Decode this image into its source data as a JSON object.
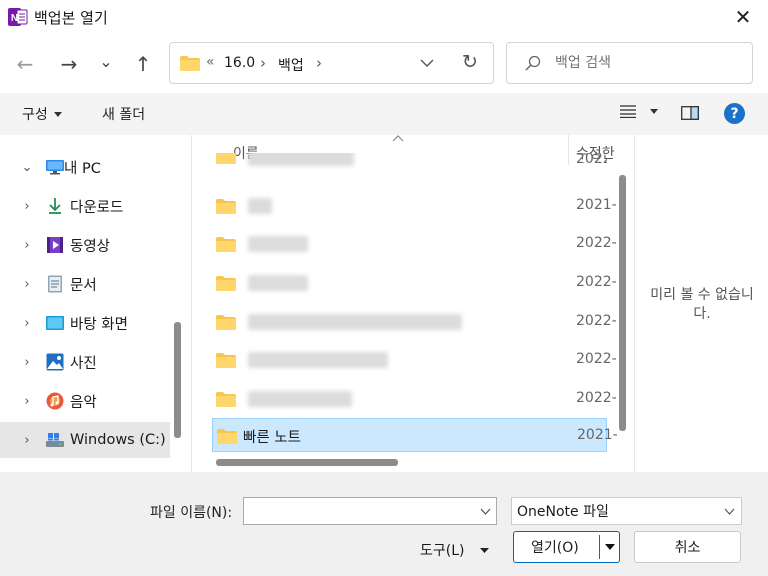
{
  "window": {
    "title": "백업본 열기",
    "app_icon_letter": "N",
    "close_glyph": "✕"
  },
  "nav": {
    "back_glyph": "←",
    "forward_glyph": "→",
    "recent_glyph": "⌄",
    "up_glyph": "↑",
    "breadcrumb_overflow": "«",
    "breadcrumb": [
      "16.0",
      "백업"
    ],
    "breadcrumb_sep": "›",
    "refresh_glyph": "↻",
    "search_placeholder": "백업 검색"
  },
  "toolbar": {
    "organize_label": "구성",
    "new_folder_label": "새 폴더",
    "help_glyph": "?"
  },
  "sidebar": {
    "items": [
      {
        "label": "내 PC",
        "icon": "pc-icon",
        "expanded": true
      },
      {
        "label": "다운로드",
        "icon": "download-icon"
      },
      {
        "label": "동영상",
        "icon": "video-icon"
      },
      {
        "label": "문서",
        "icon": "document-icon"
      },
      {
        "label": "바탕 화면",
        "icon": "desktop-icon"
      },
      {
        "label": "사진",
        "icon": "pictures-icon"
      },
      {
        "label": "음악",
        "icon": "music-icon"
      },
      {
        "label": "Windows (C:)",
        "icon": "drive-icon",
        "selected": true
      }
    ]
  },
  "filelist": {
    "columns": {
      "name": "이름",
      "modified": "수정한"
    },
    "rows": [
      {
        "name": "",
        "date": "2022-"
      },
      {
        "name": "",
        "date": "2021-"
      },
      {
        "name": "",
        "date": "2022-"
      },
      {
        "name": "",
        "date": "2022-"
      },
      {
        "name": "",
        "date": "2022-"
      },
      {
        "name": "",
        "date": "2022-"
      },
      {
        "name": "",
        "date": "2022-"
      },
      {
        "name": "빠른 노트",
        "date": "2021-",
        "selected": true
      }
    ]
  },
  "preview": {
    "message_line1": "미리 볼 수 없습니",
    "message_line2": "다."
  },
  "footer": {
    "filename_label": "파일 이름(N):",
    "filename_value": "",
    "filetype_value": "OneNote 파일",
    "tools_label": "도구(L)",
    "open_label": "열기(O)",
    "cancel_label": "취소"
  },
  "colors": {
    "accent": "#0067c0",
    "selection_bg": "#cce8ff",
    "folder": "#f8c64e",
    "onenote": "#7719aa"
  }
}
